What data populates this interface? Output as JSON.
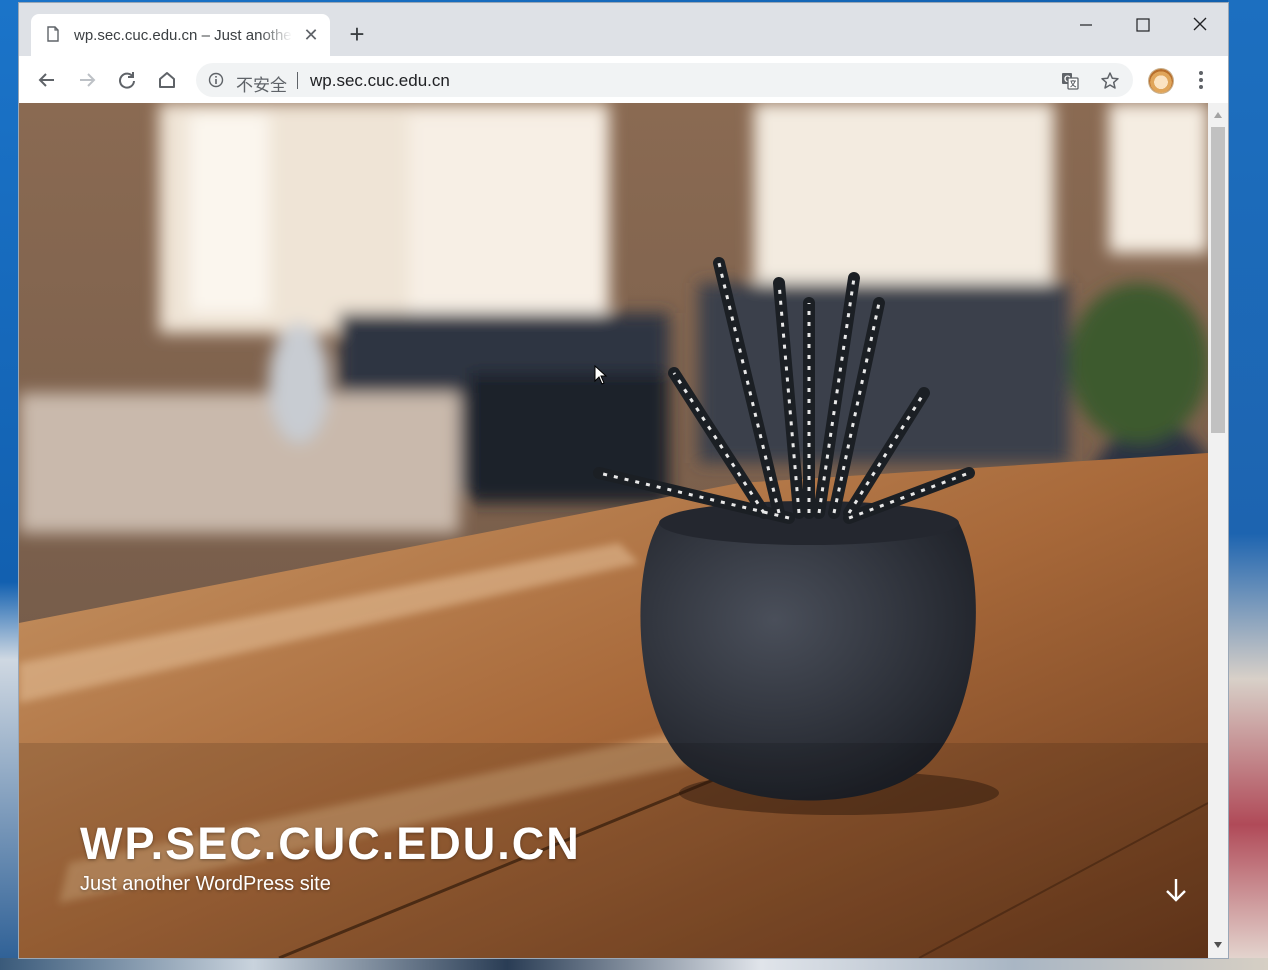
{
  "tab": {
    "title": "wp.sec.cuc.edu.cn – Just another WordPress site",
    "close_glyph": "✕",
    "new_tab_glyph": "+"
  },
  "window_controls": [
    "minimize-icon",
    "maximize-icon",
    "close-icon"
  ],
  "toolbar": {
    "icons": [
      "back-arrow-icon",
      "forward-arrow-icon",
      "reload-icon",
      "home-icon"
    ]
  },
  "omnibox": {
    "security_label": "不安全",
    "url": "wp.sec.cuc.edu.cn",
    "icons": [
      "info-icon",
      "translate-icon",
      "bookmark-star-icon"
    ]
  },
  "page": {
    "site_title": "WP.SEC.CUC.EDU.CN",
    "tagline": "Just another WordPress site",
    "scroll_icon": "arrow-down-icon",
    "hero_image": "succulent plant in dark pot on wooden table"
  },
  "colors": {
    "tabstrip": "#dee1e6",
    "omnibox": "#f1f3f4",
    "text_on_hero": "#ffffff"
  }
}
